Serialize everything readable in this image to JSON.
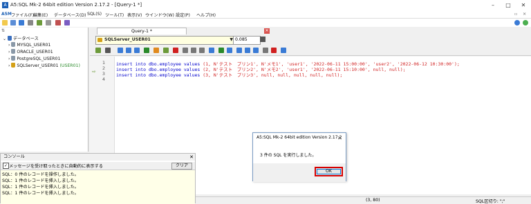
{
  "window": {
    "title": "A5:SQL Mk-2 64bit edition Version 2.17.2 - [Query-1 *]",
    "controls": [
      "–",
      "□",
      "✕"
    ]
  },
  "menu": {
    "logo": "A5M",
    "items": [
      "ファイル(F)",
      "編集(E)",
      "データベース(D)",
      "SQL(S)",
      "ツール(T)",
      "表示(V)",
      "ウインドウ(W)",
      "設定(P)",
      "ヘルプ(H)"
    ]
  },
  "tree": {
    "root": "データベース",
    "items": [
      {
        "label": "MYSQL_USER01",
        "sub": ""
      },
      {
        "label": "ORACLE_USER01",
        "sub": ""
      },
      {
        "label": "PostgreSQL_USER01",
        "sub": ""
      },
      {
        "label": "SQLServer_USER01",
        "sub": "(USER01)"
      }
    ]
  },
  "editor_tab": {
    "label": "Query-1 *"
  },
  "connection": {
    "selected": "SQLServer_USER01",
    "elapsed": "0.085"
  },
  "code": {
    "line_numbers": [
      "1",
      "2",
      "3",
      "4"
    ],
    "lines": [
      {
        "kw": "insert into dbo.employee values ",
        "str": "(1, N'テスト　プリン1', N'メモ1', 'user1', '2022-06-11 15:00:00', 'user2', '2022-06-12 10:30:00');"
      },
      {
        "kw": "insert into dbo.employee values ",
        "str": "(2, N'テスト　プリン2', N'メモ2', 'user1', '2022-06-11 15:10:00', null, null);"
      },
      {
        "kw": "insert into dbo.employee values ",
        "str": "(3, N'テスト　プリン3', null, null, null, null, null);"
      },
      {
        "kw": "",
        "str": ""
      }
    ]
  },
  "console": {
    "title": "コンソール",
    "close": "✕",
    "auto_show_label": "メッセージを受け取ったときに自動的に表示する",
    "clear_label": "クリア",
    "lines": [
      "SQL：0 件のレコードを操作しました。",
      "SQL：1 件のレコードを挿入しました。",
      "SQL：1 件のレコードを挿入しました。",
      "SQL：1 件のレコードを挿入しました。"
    ]
  },
  "status": {
    "position": "(3, 80)",
    "separator": "SQL区切り: \";\""
  },
  "dialog": {
    "title": "A5:SQL Mk-2 64bit edition Version 2.17.2",
    "message": "3 件の SQL を実行しました。",
    "ok_label": "OK",
    "close": "✕"
  },
  "colors": {
    "keyword": "#0000cc",
    "string": "#d02020",
    "highlight_border": "#d60000"
  }
}
